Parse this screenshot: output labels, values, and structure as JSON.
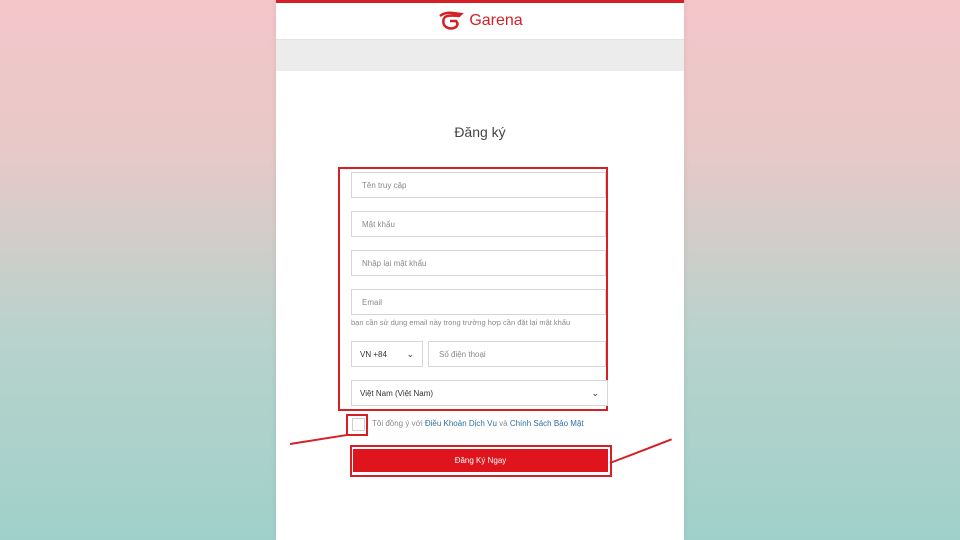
{
  "header": {
    "brand": "Garena"
  },
  "form": {
    "title": "Đăng ký",
    "username_placeholder": "Tên truy cập",
    "password_placeholder": "Mật khẩu",
    "password_confirm_placeholder": "Nhập lại mật khẩu",
    "email_placeholder": "Email",
    "email_hint": "bạn cần sử dụng email này trong trường hợp cần đặt lại mật khẩu",
    "phone_code": "VN +84",
    "phone_placeholder": "Số điện thoại",
    "country": "Việt Nam (Việt Nam)",
    "agree_prefix": "Tôi đồng ý với",
    "terms_link": "Điều Khoản Dịch Vụ",
    "agree_and": "và",
    "privacy_link": "Chính Sách Bảo Mật",
    "submit_label": "Đăng Ký Ngay",
    "agree_checked": false
  },
  "colors": {
    "brand_red": "#d42026",
    "button_red": "#e0141d",
    "link_blue": "#2f6f9e",
    "annotation_red": "#d42026"
  },
  "icons": [
    "garena-logo-icon",
    "chevron-down-icon"
  ]
}
